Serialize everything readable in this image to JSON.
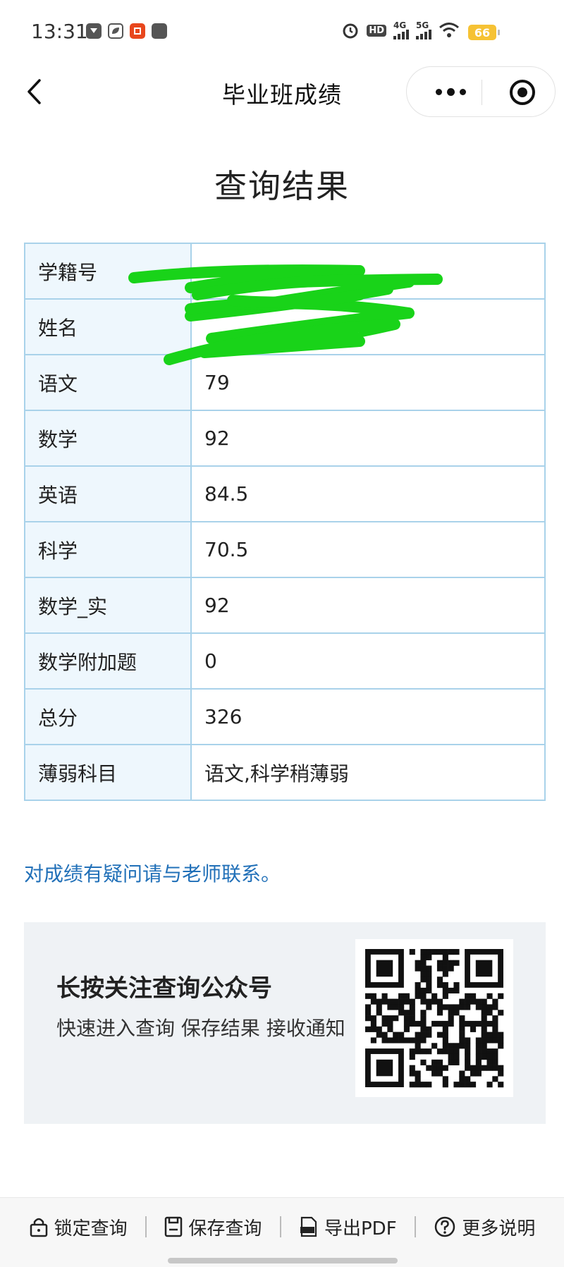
{
  "status_bar": {
    "time": "13:31",
    "network_4g": "4G",
    "network_5g": "5G",
    "hd_label": "HD",
    "battery": "66"
  },
  "header": {
    "title": "毕业班成绩"
  },
  "result": {
    "title": "查询结果",
    "rows": [
      {
        "label": "学籍号",
        "value": ""
      },
      {
        "label": "姓名",
        "value": ""
      },
      {
        "label": "语文",
        "value": "79"
      },
      {
        "label": "数学",
        "value": "92"
      },
      {
        "label": "英语",
        "value": "84.5"
      },
      {
        "label": "科学",
        "value": "70.5"
      },
      {
        "label": "数学_实",
        "value": "92"
      },
      {
        "label": "数学附加题",
        "value": "0"
      },
      {
        "label": "总分",
        "value": "326"
      },
      {
        "label": "薄弱科目",
        "value": "语文,科学稍薄弱"
      }
    ],
    "note": "对成绩有疑问请与老师联系。"
  },
  "promo": {
    "title": "长按关注查询公众号",
    "desc": "快速进入查询 保存结果 接收通知"
  },
  "bottom_bar": {
    "lock": "锁定查询",
    "save": "保存查询",
    "export": "导出PDF",
    "more": "更多说明"
  },
  "colors": {
    "table_border": "#a9d2ea",
    "label_bg": "#eef7fd",
    "link_blue": "#2170b8",
    "redaction_green": "#19d319"
  }
}
